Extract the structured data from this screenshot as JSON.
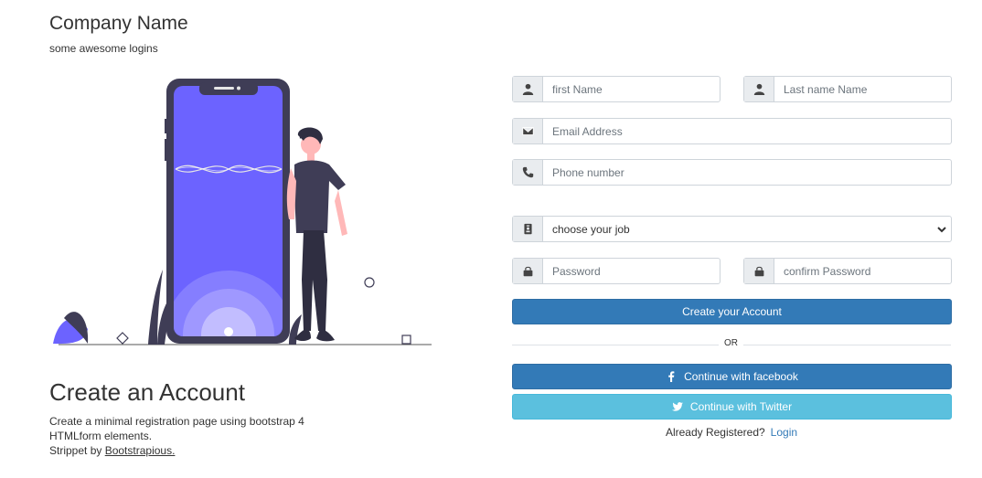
{
  "brand": {
    "title": "Company Name",
    "subtitle": "some awesome logins"
  },
  "intro": {
    "title": "Create an Account",
    "description": "Create a minimal registration page using bootstrap 4 HTMLform elements.",
    "credit_prefix": "Strippet by ",
    "credit_link": "Bootstrapious."
  },
  "form": {
    "first_name": {
      "placeholder": "first Name",
      "icon": "user-icon"
    },
    "last_name": {
      "placeholder": "Last name Name",
      "icon": "user-icon"
    },
    "email": {
      "placeholder": "Email Address",
      "icon": "envelope-icon"
    },
    "phone": {
      "placeholder": "Phone number",
      "icon": "phone-icon"
    },
    "job": {
      "selected": "choose your job",
      "icon": "id-card-icon"
    },
    "password": {
      "placeholder": "Password",
      "icon": "lock-icon"
    },
    "confirm_password": {
      "placeholder": "confirm Password",
      "icon": "lock-icon"
    },
    "submit_label": "Create your Account",
    "divider_text": "OR",
    "facebook_label": "Continue with facebook",
    "twitter_label": "Continue with Twitter",
    "already_text": "Already Registered?",
    "login_link": "Login"
  },
  "colors": {
    "primary": "#337ab7",
    "twitter": "#5bc0de",
    "illustration_accent": "#6c63ff"
  }
}
